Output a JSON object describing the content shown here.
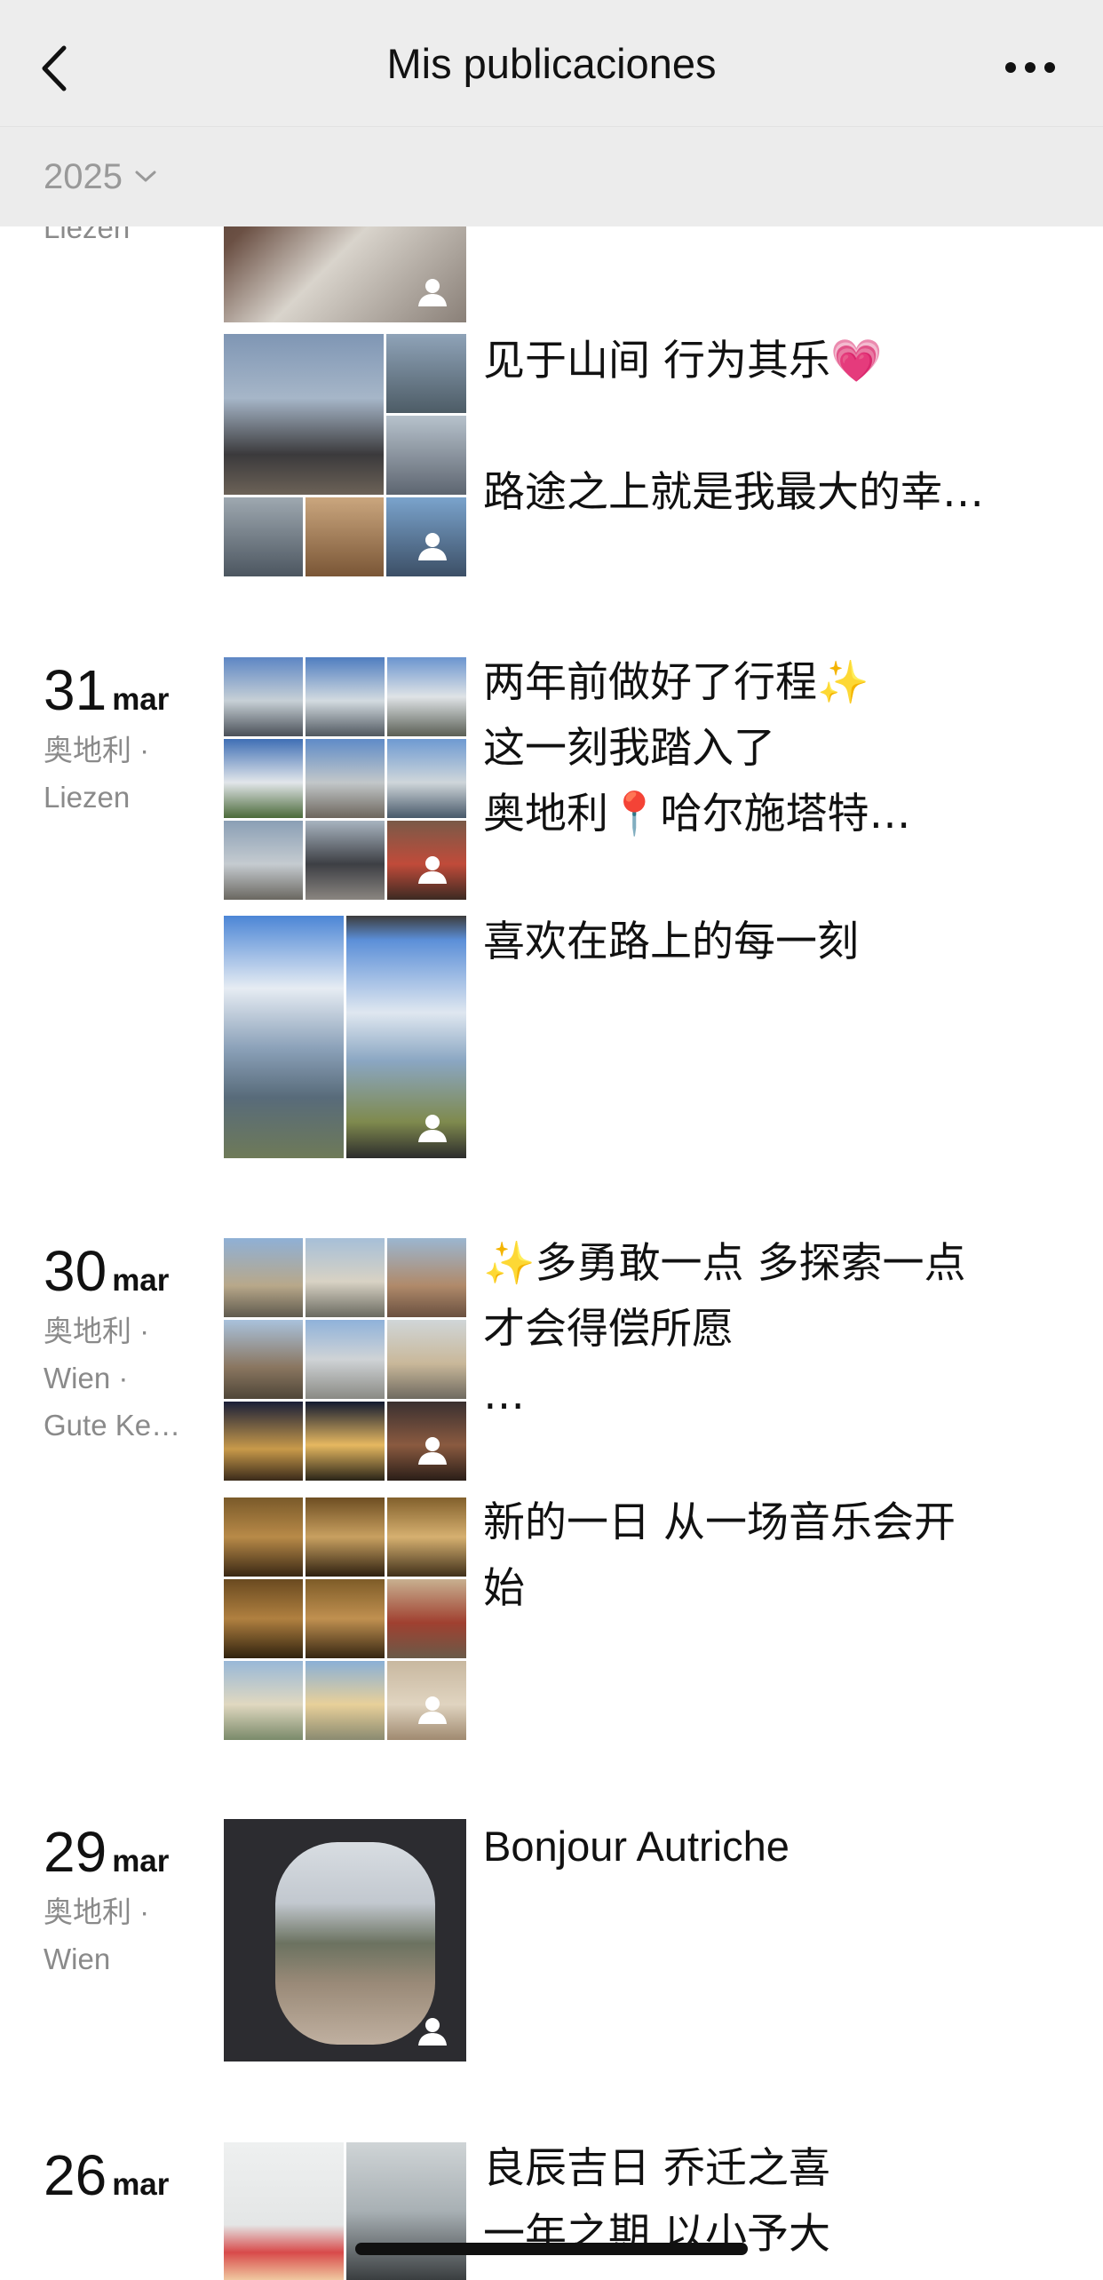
{
  "header": {
    "title": "Mis publicaciones",
    "year_filter": "2025"
  },
  "entries": [
    {
      "location": "Liezen",
      "posts": [
        {
          "text": ""
        },
        {
          "text": "见于山间  行为其乐💗\n\n路途之上就是我最大的幸…"
        }
      ]
    },
    {
      "day": "31",
      "month": "mar",
      "location": "奥地利 ·\nLiezen",
      "posts": [
        {
          "text": "两年前做好了行程✨\n这一刻我踏入了\n奥地利📍哈尔施塔特…"
        },
        {
          "text": "喜欢在路上的每一刻"
        }
      ]
    },
    {
      "day": "30",
      "month": "mar",
      "location": "奥地利 ·\nWien ·\nGute Ke…",
      "posts": [
        {
          "text": "✨多勇敢一点  多探索一点\n 才会得偿所愿\n…"
        },
        {
          "text": "新的一日  从一场音乐会开\n始"
        }
      ]
    },
    {
      "day": "29",
      "month": "mar",
      "location": "奥地利 ·\nWien",
      "posts": [
        {
          "text": "Bonjour Autriche"
        }
      ]
    },
    {
      "day": "26",
      "month": "mar",
      "location": "",
      "posts": [
        {
          "text": "良辰吉日  乔迁之喜\n一年之期  以小予大"
        }
      ]
    }
  ],
  "icons": {
    "back": "chevron-left-icon",
    "more": "more-dots-icon",
    "year": "chevron-down-icon",
    "visibility": "person-icon"
  },
  "colors": {
    "header_bg": "#ededed",
    "muted_text": "#8a8a8a"
  }
}
